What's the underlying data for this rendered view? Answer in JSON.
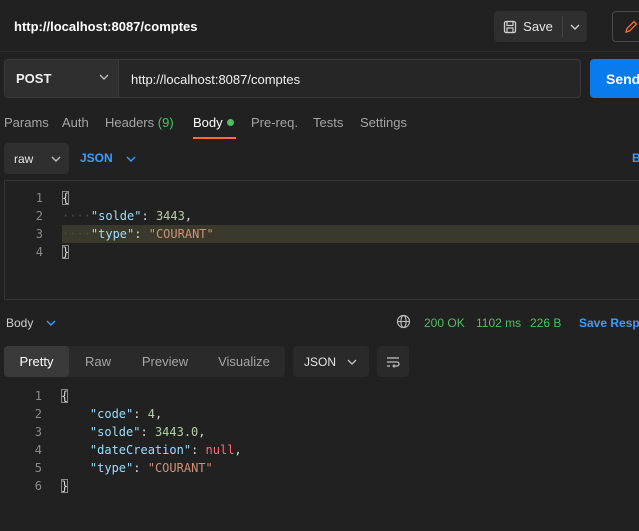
{
  "header": {
    "title": "http://localhost:8087/comptes",
    "save_label": "Save"
  },
  "request": {
    "method": "POST",
    "url": "http://localhost:8087/comptes",
    "send_label": "Send"
  },
  "tabs": [
    {
      "label": "Params"
    },
    {
      "label": "Auth"
    },
    {
      "label": "Headers",
      "count": "(9)"
    },
    {
      "label": "Body"
    },
    {
      "label": "Pre-req."
    },
    {
      "label": "Tests"
    },
    {
      "label": "Settings"
    }
  ],
  "body_mode": {
    "type": "raw",
    "format": "JSON",
    "beautify": "B"
  },
  "request_body": {
    "line_numbers": [
      "1",
      "2",
      "3",
      "4"
    ],
    "open_brace": "{",
    "close_brace": "}",
    "solde_key": "\"solde\"",
    "solde_value": "3443",
    "type_key": "\"type\"",
    "type_value": "\"COURANT\""
  },
  "response": {
    "label": "Body",
    "status": "200 OK",
    "time": "1102 ms",
    "size": "226 B",
    "save_label": "Save Resp"
  },
  "view_tabs": [
    "Pretty",
    "Raw",
    "Preview",
    "Visualize"
  ],
  "response_format": "JSON",
  "response_body": {
    "line_numbers": [
      "1",
      "2",
      "3",
      "4",
      "5",
      "6"
    ],
    "open_brace": "{",
    "close_brace": "}",
    "code_key": "\"code\"",
    "code_value": "4",
    "solde_key": "\"solde\"",
    "solde_value": "3443.0",
    "date_key": "\"dateCreation\"",
    "date_value": "null",
    "type_key": "\"type\"",
    "type_value": "\"COURANT\""
  },
  "colors": {
    "accent": "#ff6c37",
    "send": "#097bed",
    "success": "#4fbf5f",
    "link": "#3c9dff"
  }
}
